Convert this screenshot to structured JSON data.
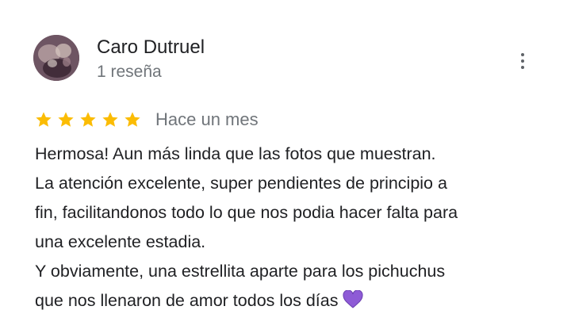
{
  "review": {
    "author": "Caro Dutruel",
    "review_count": "1 reseña",
    "rating": 5,
    "rating_max": 5,
    "date": "Hace un mes",
    "lines": [
      "Hermosa! Aun más linda que las fotos que muestran.",
      "La atención excelente, super pendientes de principio a",
      "fin, facilitandonos todo lo que nos podia hacer falta para",
      "una excelente estadia.",
      "Y obviamente, una estrellita aparte para los pichuchus",
      "que nos llenaron de amor todos los días"
    ],
    "trailing_icon": "purple-heart-emoji"
  },
  "icons": {
    "more": "more-vertical-icon",
    "star": "star-icon"
  },
  "colors": {
    "star": "#fbbc04",
    "secondary_text": "#70757a",
    "primary_text": "#202124",
    "heart": "#8e5bd6"
  }
}
